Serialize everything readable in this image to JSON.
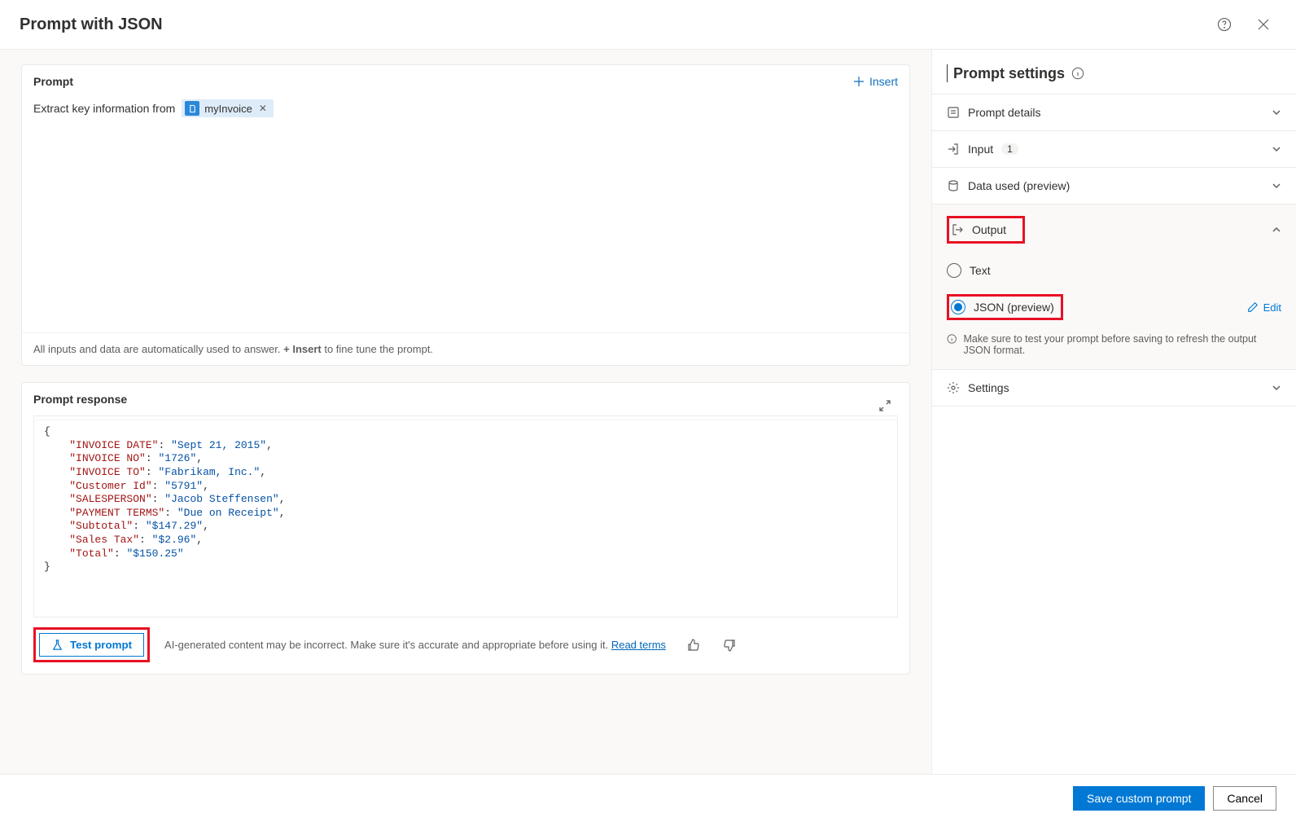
{
  "header": {
    "title": "Prompt with JSON"
  },
  "prompt": {
    "section_title": "Prompt",
    "insert_label": "Insert",
    "prefix_text": "Extract key information from",
    "chip_label": "myInvoice",
    "footer_pre": "All inputs and data are automatically used to answer. ",
    "footer_bold": "+ Insert",
    "footer_post": " to fine tune the prompt."
  },
  "response": {
    "section_title": "Prompt response",
    "json": {
      "INVOICE DATE": "Sept 21, 2015",
      "INVOICE NO": "1726",
      "INVOICE TO": "Fabrikam, Inc.",
      "Customer Id": "5791",
      "SALESPERSON": "Jacob Steffensen",
      "PAYMENT TERMS": "Due on Receipt",
      "Subtotal": "$147.29",
      "Sales Tax": "$2.96",
      "Total": "$150.25"
    },
    "test_label": "Test prompt",
    "disclaimer": "AI-generated content may be incorrect. Make sure it's accurate and appropriate before using it.",
    "terms_link": "Read terms"
  },
  "sidebar": {
    "title": "Prompt settings",
    "rows": {
      "details": "Prompt details",
      "input": "Input",
      "input_count": "1",
      "data_used": "Data used (preview)",
      "output": "Output",
      "settings": "Settings"
    },
    "output": {
      "text_option": "Text",
      "json_option": "JSON (preview)",
      "edit_label": "Edit",
      "info_text": "Make sure to test your prompt before saving to refresh the output JSON format."
    }
  },
  "footer": {
    "save": "Save custom prompt",
    "cancel": "Cancel"
  }
}
